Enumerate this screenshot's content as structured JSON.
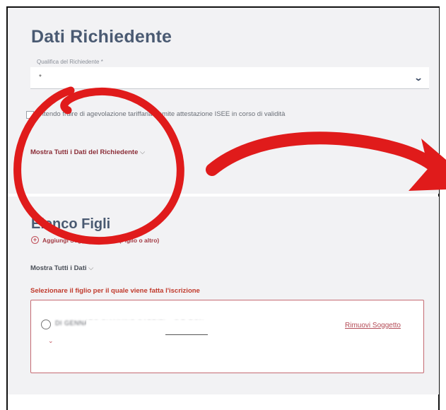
{
  "requester": {
    "title": "Dati Richiedente",
    "qualifica_label": "Qualifica del Richiedente *",
    "qualifica_value": "*",
    "isee_checkbox_label": "Intendo fruire di agevolazione tariffaria tramite attestazione ISEE in corso di validità",
    "isee_checked": false,
    "show_all_link": "Mostra Tutti i Dati del Richiedente"
  },
  "children": {
    "title": "Elenco Figli",
    "add_link": "Aggiungi Soggetto Utenza (Figlio o altro)",
    "show_all_link": "Mostra Tutti i Dati",
    "select_prompt": "Selezionare il figlio per il quale viene fatta l'iscrizione",
    "child_entry": "DI GENNARO GIANNINO GABRIEL - C.F. DGN",
    "remove_link": "Rimuovi Soggetto"
  },
  "icons": {
    "select_chevron": "chevron-down-icon",
    "link_chevron": "chevron-down-icon",
    "add": "plus-circle-icon"
  },
  "colors": {
    "annotation_red": "#e01b1b",
    "title_slate": "#4a5a72",
    "link_red": "#c0392b"
  }
}
